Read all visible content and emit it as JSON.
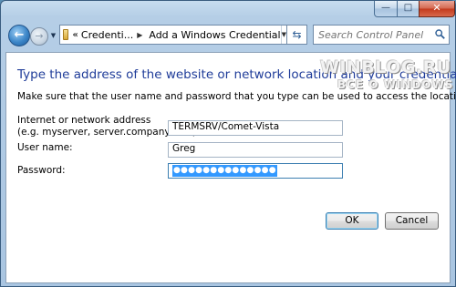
{
  "window": {
    "minimize_glyph": "—",
    "maximize_glyph": "□",
    "close_glyph": "✕"
  },
  "nav": {
    "back_glyph": "←",
    "forward_glyph": "→",
    "history_glyph": "▼"
  },
  "address": {
    "overflow_glyph": "«",
    "breadcrumbs": [
      "Credenti...",
      "Add a Windows Credential"
    ],
    "arrow_glyph": "▶",
    "dropdown_glyph": "▼",
    "refresh_glyph": "⇆"
  },
  "search": {
    "placeholder": "Search Control Panel",
    "icon": "magnifier"
  },
  "page": {
    "heading": "Type the address of the website or network location and your credentials",
    "subtext": "Make sure that the user name and password that you type can be used to access the location."
  },
  "form": {
    "address_label_line1": "Internet or network address",
    "address_label_line2": "(e.g. myserver, server.company.com):",
    "address_value": "TERMSRV/Comet-Vista",
    "username_label": "User name:",
    "username_value": "Greg",
    "password_label": "Password:",
    "password_value": "●●●●●●●●●●●●●●"
  },
  "buttons": {
    "ok": "OK",
    "cancel": "Cancel"
  },
  "watermark": {
    "line1": "WINBLOG.RU",
    "line2": "ВСЕ О WINDOWS"
  },
  "colors": {
    "heading": "#1f3c99",
    "selection": "#3399ff",
    "close_button": "#c3391c",
    "frame": "#a9c5e1"
  }
}
